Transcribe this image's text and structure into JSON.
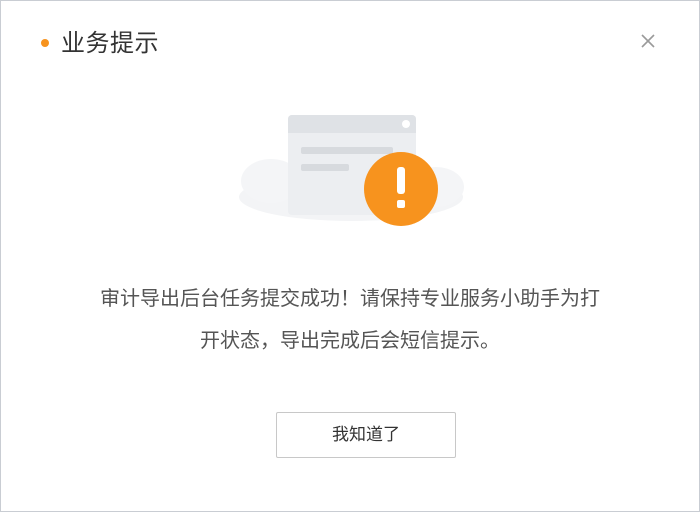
{
  "dialog": {
    "title": "业务提示",
    "close_icon": "close-icon",
    "accent_color": "#f7931e",
    "illustration_icon": "warning-exclamation-icon",
    "message_line1": "审计导出后台任务提交成功！请保持专业服务小助手为打",
    "message_line2": "开状态，导出完成后会短信提示。",
    "ok_label": "我知道了"
  }
}
